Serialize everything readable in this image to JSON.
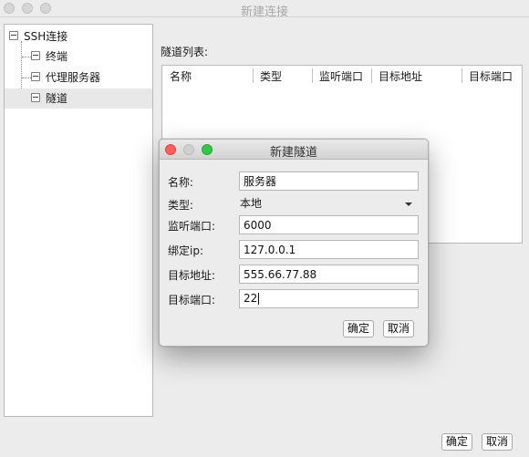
{
  "window": {
    "title": "新建连接"
  },
  "tree": {
    "root": {
      "label": "SSH连接"
    },
    "children": [
      {
        "label": "终端"
      },
      {
        "label": "代理服务器"
      },
      {
        "label": "隧道",
        "selected": true
      }
    ]
  },
  "tunnel_list": {
    "label": "隧道列表:",
    "columns": [
      "名称",
      "类型",
      "监听端口",
      "目标地址",
      "目标端口"
    ]
  },
  "footer": {
    "ok_label": "确定",
    "cancel_label": "取消"
  },
  "dialog": {
    "title": "新建隧道",
    "fields": {
      "name": {
        "label": "名称:",
        "value": "服务器"
      },
      "type": {
        "label": "类型:",
        "value": "本地"
      },
      "listen_port": {
        "label": "监听端口:",
        "value": "6000"
      },
      "bind_ip": {
        "label": "绑定ip:",
        "value": "127.0.0.1"
      },
      "target_addr": {
        "label": "目标地址:",
        "value": "555.66.77.88"
      },
      "target_port": {
        "label": "目标端口:",
        "value": "22"
      }
    },
    "ok_label": "确定",
    "cancel_label": "取消"
  },
  "colors": {
    "close": "#fc5f57",
    "minimize": "#d0d0d0",
    "zoom": "#33c748",
    "selection": "#e8e8e8"
  }
}
